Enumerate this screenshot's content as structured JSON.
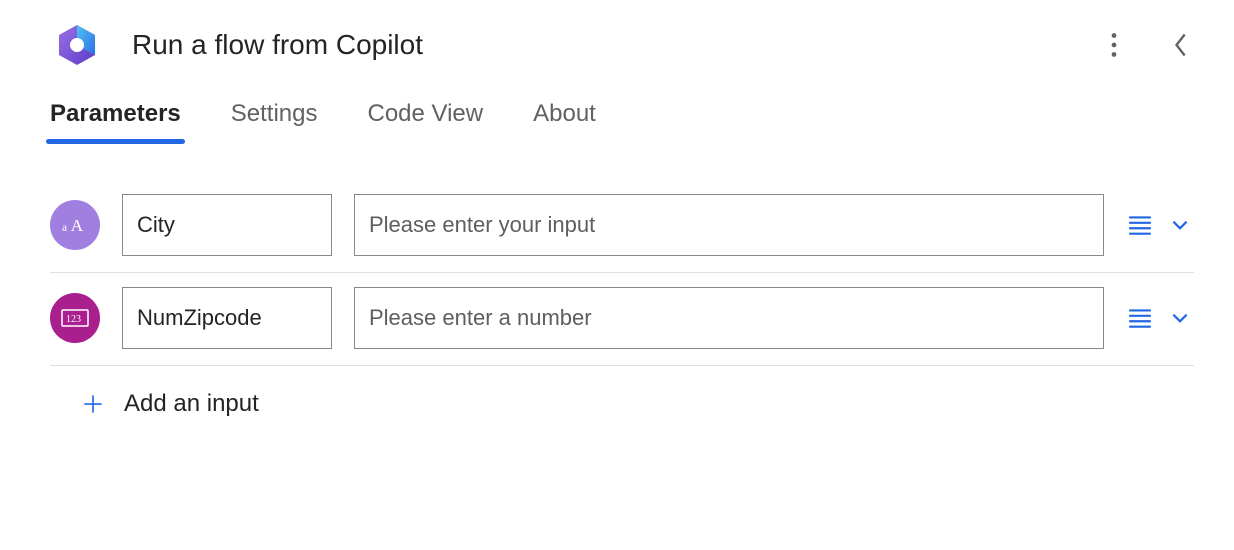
{
  "header": {
    "title": "Run a flow from Copilot"
  },
  "tabs": [
    {
      "label": "Parameters",
      "active": true
    },
    {
      "label": "Settings",
      "active": false
    },
    {
      "label": "Code View",
      "active": false
    },
    {
      "label": "About",
      "active": false
    }
  ],
  "parameters": [
    {
      "type": "text",
      "name": "City",
      "placeholder": "Please enter your input"
    },
    {
      "type": "number",
      "name": "NumZipcode",
      "placeholder": "Please enter a number"
    }
  ],
  "addInput": {
    "label": "Add an input"
  },
  "colors": {
    "accent": "#2266E3",
    "textBadge": "#A07FE0",
    "numberBadge": "#AA1F8E"
  }
}
